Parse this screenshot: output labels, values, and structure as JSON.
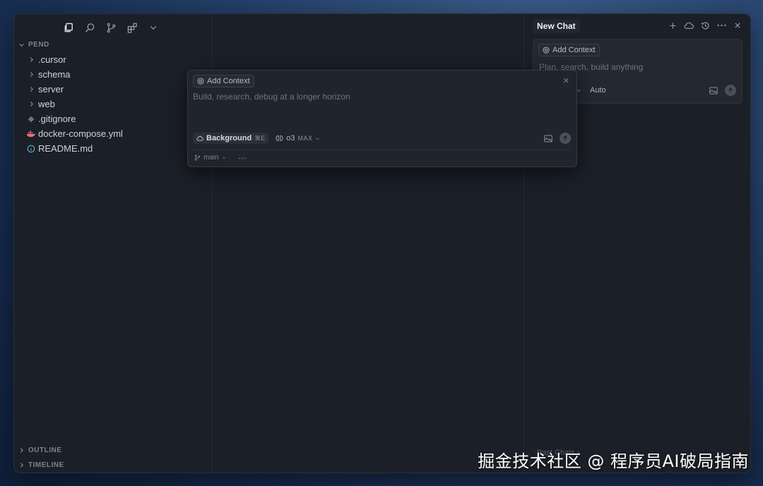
{
  "sidebar": {
    "toolbar_icons": [
      "files-icon",
      "search-icon",
      "source-control-icon",
      "extensions-icon",
      "chevron-down-icon"
    ],
    "project_label": "PEND",
    "tree": [
      {
        "type": "folder",
        "label": ".cursor"
      },
      {
        "type": "folder",
        "label": "schema"
      },
      {
        "type": "folder",
        "label": "server"
      },
      {
        "type": "folder",
        "label": "web"
      },
      {
        "type": "file",
        "label": ".gitignore",
        "icon": "git-icon"
      },
      {
        "type": "file",
        "label": "docker-compose.yml",
        "icon": "docker-icon"
      },
      {
        "type": "file",
        "label": "README.md",
        "icon": "info-icon"
      }
    ],
    "outline_label": "OUTLINE",
    "timeline_label": "TIMELINE"
  },
  "chat": {
    "tab_title": "New Chat",
    "add_context": "Add Context",
    "placeholder": "Plan, search, build anything",
    "mode": "Auto",
    "past_chats": "Past Chats"
  },
  "composer": {
    "add_context": "Add Context",
    "placeholder": "Build, research, debug at a longer horizon",
    "background_label": "Background",
    "background_shortcut": "⌘E",
    "model": "o3",
    "model_tag": "MAX",
    "branch": "main"
  },
  "watermark": "掘金技术社区 @ 程序员AI破局指南",
  "colors": {
    "window_bg": "#1b1f27",
    "accent_docker": "#e8707f",
    "info_icon": "#5fb3d9"
  }
}
